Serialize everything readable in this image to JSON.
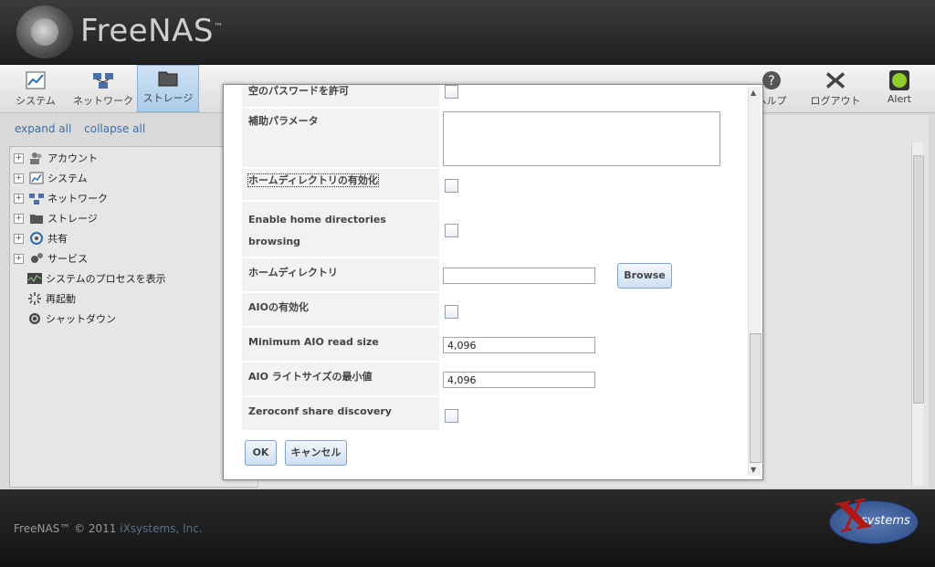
{
  "brand": {
    "name": "FreeNAS",
    "tm": "™"
  },
  "toolbar": {
    "items": [
      {
        "label": "システム",
        "icon": "system-chart-icon"
      },
      {
        "label": "ネットワーク",
        "icon": "network-icon"
      },
      {
        "label": "ストレージ",
        "icon": "storage-folder-icon"
      },
      {
        "label": "ヘルプ",
        "icon": "help-icon"
      },
      {
        "label": "ログアウト",
        "icon": "logout-x-icon"
      },
      {
        "label": "Alert",
        "icon": "alert-light-icon"
      }
    ]
  },
  "left": {
    "expand_all": "expand all",
    "collapse_all": "collapse all",
    "tree": [
      {
        "label": "アカウント",
        "expandable": true
      },
      {
        "label": "システム",
        "expandable": true
      },
      {
        "label": "ネットワーク",
        "expandable": true
      },
      {
        "label": "ストレージ",
        "expandable": true
      },
      {
        "label": "共有",
        "expandable": true
      },
      {
        "label": "サービス",
        "expandable": true
      },
      {
        "label": "システムのプロセスを表示",
        "expandable": false
      },
      {
        "label": "再起動",
        "expandable": false
      },
      {
        "label": "シャットダウン",
        "expandable": false
      }
    ]
  },
  "dialog": {
    "allow_empty_password_label": "空のパスワードを許可",
    "aux_params_label": "補助パラメータ",
    "aux_params_value": "",
    "enable_home_label": "ホームディレクトリの有効化",
    "enable_home_browsing_label_1": "Enable home directories",
    "enable_home_browsing_label_2": "browsing",
    "home_dir_label": "ホームディレクトリ",
    "home_dir_value": "",
    "browse_label": "Browse",
    "aio_enable_label": "AIOの有効化",
    "min_aio_read_label": "Minimum AIO read size",
    "min_aio_read_value": "4,096",
    "min_aio_write_label": "AIO ライトサイズの最小値",
    "min_aio_write_value": "4,096",
    "zeroconf_label": "Zeroconf share discovery",
    "ok_label": "OK",
    "cancel_label": "キャンセル"
  },
  "footer": {
    "text": "FreeNAS™ © 2011 ",
    "company": "iXsystems, Inc.",
    "logo_text": "systems"
  }
}
